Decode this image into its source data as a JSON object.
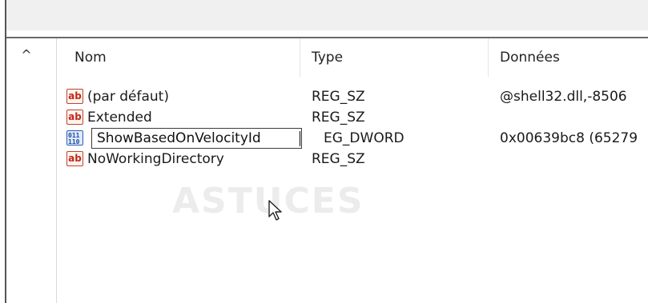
{
  "columns": {
    "name": "Nom",
    "type": "Type",
    "data": "Données"
  },
  "rows": [
    {
      "icon": "string-value-icon",
      "name": "(par défaut)",
      "type": "REG_SZ",
      "data": "@shell32.dll,-8506"
    },
    {
      "icon": "string-value-icon",
      "name": "Extended",
      "type": "REG_SZ",
      "data": ""
    },
    {
      "icon": "binary-value-icon",
      "name": "ShowBasedOnVelocityId",
      "type": "EG_DWORD",
      "data": "0x00639bc8 (65279",
      "editing": true
    },
    {
      "icon": "string-value-icon",
      "name": "NoWorkingDirectory",
      "type": "REG_SZ",
      "data": ""
    }
  ],
  "icons": {
    "string_label": "ab",
    "up_arrow": "^"
  },
  "watermark": "ASTUCES",
  "colors": {
    "string_icon": "#c0281a",
    "binary_icon": "#2a5fb2",
    "border": "#555555"
  }
}
